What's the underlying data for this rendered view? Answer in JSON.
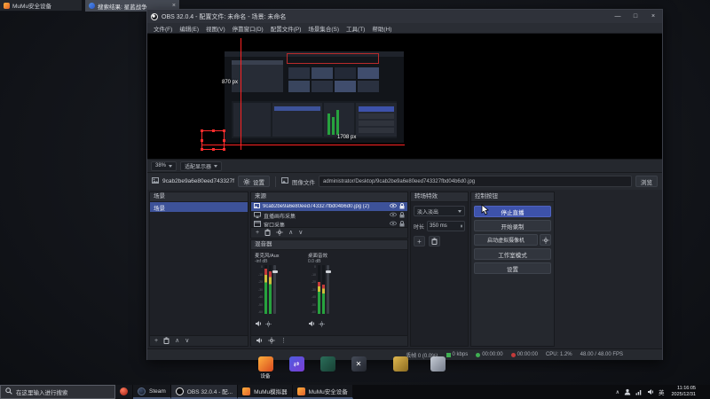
{
  "glyphs": {
    "plus": "+",
    "up": "∧",
    "down": "∨",
    "kebab": "⋮",
    "spin_up": "▴",
    "spin_down": "▾",
    "min": "—",
    "max": "□",
    "close": "×"
  },
  "colors": {
    "accent_blue": "#3d52aa",
    "selection_blue": "#3d5299",
    "overlay_red": "#ff2323",
    "meter_green": "#27a23e"
  },
  "desktop": {
    "fragments": {
      "mumu_security": "MuMu安全设备",
      "browser_tab": "搜索结果: 星蓝战争"
    },
    "icon_label": "设备"
  },
  "obs": {
    "title": "OBS 32.0.4 - 配置文件: 未命名 - 场景: 未命名",
    "menu": [
      "文件(F)",
      "编辑(E)",
      "视图(V)",
      "停靠窗口(D)",
      "配置文件(P)",
      "场景集合(S)",
      "工具(T)",
      "帮助(H)"
    ],
    "preview": {
      "height_label": "870 px",
      "width_label": "1708 px"
    },
    "zoombar": {
      "zoom": "38%",
      "fit": "适配显示器"
    },
    "props": {
      "source_name": "9cab2be9a6e80eed743327f",
      "settings": "设置",
      "field": "图像文件",
      "path": "administrator/Desktop/9cab2be9a6e80eed743327fbd04b6d0.jpg",
      "browse": "浏览"
    },
    "scenes": {
      "title": "场景",
      "item": "场景"
    },
    "sources": {
      "title": "来源",
      "items": [
        "9cab2be9a6e80eed743327fbd04b6d0.jpg (2)",
        "直播画布采集",
        "窗口采集"
      ]
    },
    "mixer": {
      "title": "混音器",
      "ch1_name": "麦克风/Aux",
      "ch1_db": "-inf dB",
      "ch2_name": "桌面音效",
      "ch2_db": "0.0 dB",
      "scale": [
        "0",
        "-10",
        "-20",
        "-30",
        "-40",
        "-50",
        "-60"
      ]
    },
    "transitions": {
      "title": "转场特效",
      "selected": "淡入淡出",
      "duration_label": "时长",
      "duration": "350 ms"
    },
    "controls": {
      "title": "控制按钮",
      "stop_stream": "停止直播",
      "start_record": "开始录制",
      "virtual_cam": "启动虚拟摄像机",
      "studio_mode": "工作室模式",
      "settings": "设置"
    },
    "status": {
      "dropped": "丢帧 0 (0.0%)",
      "bitrate": "0 kbps",
      "live": "00:00:00",
      "rec": "00:00:00",
      "cpu": "CPU: 1.2%",
      "fps": "48.00 / 48.00 FPS"
    }
  },
  "taskbar": {
    "search": "在这里输入进行搜索",
    "apps": [
      "Steam",
      "OBS 32.0.4 - 配...",
      "MuMu模拟器",
      "MuMu安全设备"
    ],
    "tray": {
      "ime": "英",
      "time": "11:16:05",
      "date": "2025/12/31"
    }
  }
}
